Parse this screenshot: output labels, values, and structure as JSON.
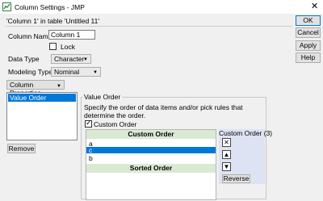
{
  "window": {
    "title": "Column Settings - JMP",
    "close_glyph": "✕"
  },
  "subtitle": "'Column 1' in table 'Untitled 11'",
  "fields": {
    "column_name_label": "Column Name",
    "column_name_value": "Column 1",
    "lock_label": "Lock",
    "data_type_label": "Data Type",
    "data_type_value": "Character",
    "modeling_type_label": "Modeling Type",
    "modeling_type_value": "Nominal"
  },
  "column_properties": {
    "button_label": "Column Properties",
    "items": [
      "Value Order"
    ],
    "remove_label": "Remove"
  },
  "value_order": {
    "legend": "Value Order",
    "description": "Specify the order of data items and/or pick rules that determine the order.",
    "custom_order_checkbox": "Custom Order",
    "custom_order_header": "Custom Order",
    "sorted_order_header": "Sorted Order",
    "items": [
      "a",
      "c",
      "b"
    ],
    "selected_index": 1,
    "side_title": "Custom Order (3)",
    "reverse_label": "Reverse"
  },
  "buttons": {
    "ok": "OK",
    "cancel": "Cancel",
    "apply": "Apply",
    "help": "Help"
  },
  "icons": {
    "app": "jmp-app-icon",
    "delete": "delete-x-icon",
    "up": "move-up-icon",
    "down": "move-down-icon"
  },
  "colors": {
    "selection": "#0078d7",
    "header_green": "#d9ead3",
    "side_panel": "#dde3f3"
  }
}
